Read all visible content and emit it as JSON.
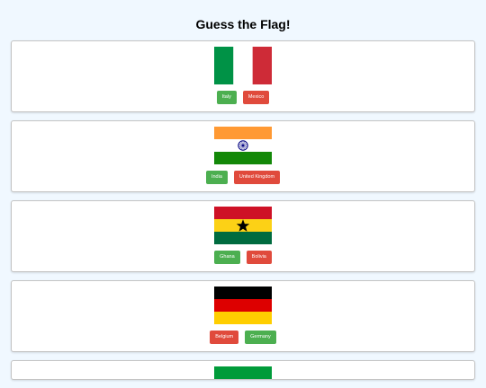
{
  "page": {
    "title": "Guess the Flag!"
  },
  "colors": {
    "correct": "#4caf50",
    "wrong": "#e04a3c",
    "background": "#f0f8ff"
  },
  "cards": [
    {
      "flag": "italy-flag",
      "options": [
        {
          "label": "Italy",
          "color": "green"
        },
        {
          "label": "Mexico",
          "color": "red"
        }
      ]
    },
    {
      "flag": "india-flag",
      "options": [
        {
          "label": "India",
          "color": "green"
        },
        {
          "label": "United Kingdom",
          "color": "red"
        }
      ]
    },
    {
      "flag": "ghana-flag",
      "options": [
        {
          "label": "Ghana",
          "color": "green"
        },
        {
          "label": "Bolivia",
          "color": "red"
        }
      ]
    },
    {
      "flag": "germany-flag",
      "options": [
        {
          "label": "Belgium",
          "color": "red"
        },
        {
          "label": "Germany",
          "color": "green"
        }
      ]
    }
  ]
}
